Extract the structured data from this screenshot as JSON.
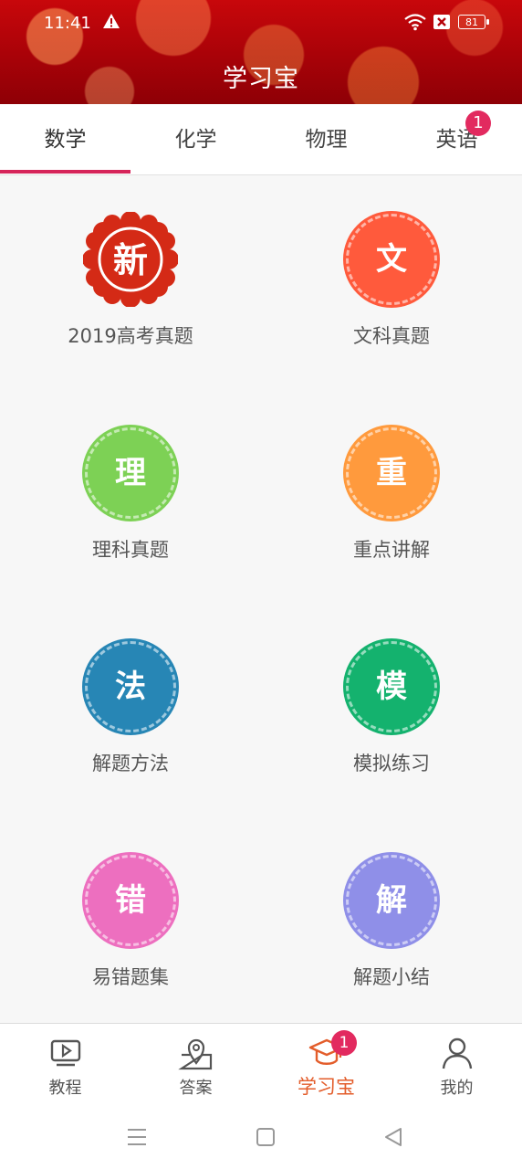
{
  "status_bar": {
    "time": "11:41",
    "battery": "81",
    "icons": [
      "warning-icon",
      "wifi-icon",
      "notification-icon",
      "battery-icon"
    ]
  },
  "header": {
    "title": "学习宝"
  },
  "tabs": {
    "items": [
      {
        "label": "数学",
        "active": true
      },
      {
        "label": "化学",
        "active": false
      },
      {
        "label": "物理",
        "active": false
      },
      {
        "label": "英语",
        "active": false,
        "badge": "1"
      }
    ]
  },
  "grid": {
    "items": [
      {
        "label": "2019高考真题",
        "glyph": "新",
        "color": "#d42a16",
        "icon": "new-seal-icon"
      },
      {
        "label": "文科真题",
        "glyph": "文",
        "color": "#ff5a3c",
        "icon": "wen-icon"
      },
      {
        "label": "理科真题",
        "glyph": "理",
        "color": "#7dd155",
        "icon": "li-icon"
      },
      {
        "label": "重点讲解",
        "glyph": "重",
        "color": "#ff9a3d",
        "icon": "zhong-icon"
      },
      {
        "label": "解题方法",
        "glyph": "法",
        "color": "#2786b5",
        "icon": "fa-icon"
      },
      {
        "label": "模拟练习",
        "glyph": "模",
        "color": "#14b26e",
        "icon": "mo-icon"
      },
      {
        "label": "易错题集",
        "glyph": "错",
        "color": "#ed6fbf",
        "icon": "cuo-icon"
      },
      {
        "label": "解题小结",
        "glyph": "解",
        "color": "#8f8fe8",
        "icon": "jie-icon"
      }
    ]
  },
  "bottom_nav": {
    "items": [
      {
        "label": "教程",
        "icon": "video-play-icon",
        "active": false
      },
      {
        "label": "答案",
        "icon": "map-pin-icon",
        "active": false
      },
      {
        "label": "学习宝",
        "icon": "graduation-cap-icon",
        "active": true,
        "badge": "1"
      },
      {
        "label": "我的",
        "icon": "user-icon",
        "active": false
      }
    ]
  },
  "system_nav": [
    "menu-icon",
    "home-icon",
    "back-icon"
  ],
  "colors": {
    "accent": "#d6255a",
    "active_nav": "#e35d2b",
    "badge": "#e22a5f",
    "header_red": "#b50209"
  }
}
